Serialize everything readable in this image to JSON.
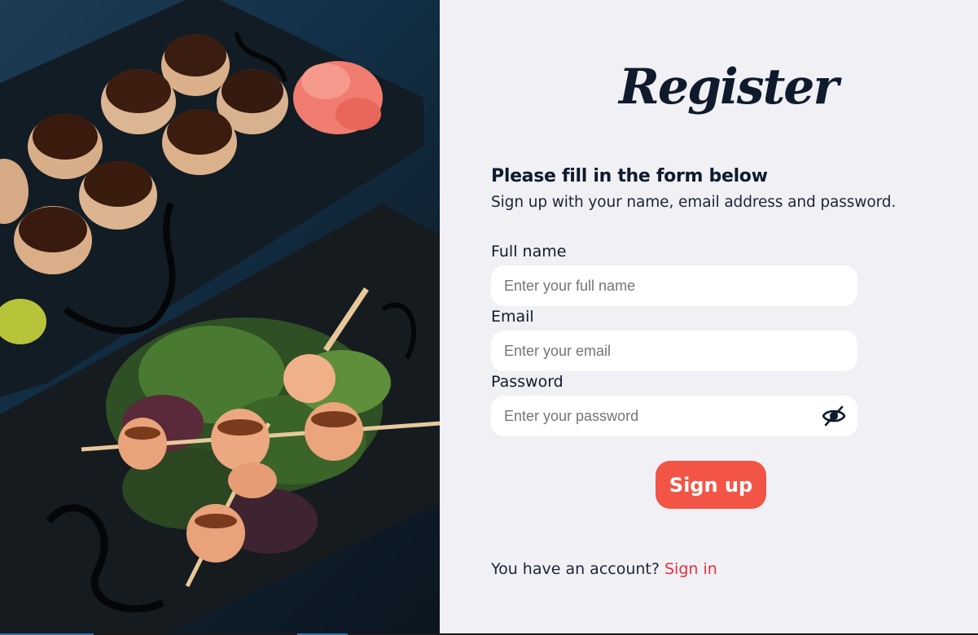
{
  "brand": {
    "title": "Register"
  },
  "form": {
    "heading": "Please fill in the form below",
    "subheading": "Sign up with your name, email address and password.",
    "fields": [
      {
        "label": "Full name",
        "placeholder": "Enter your full name",
        "value": ""
      },
      {
        "label": "Email",
        "placeholder": "Enter your email",
        "value": ""
      },
      {
        "label": "Password",
        "placeholder": "Enter your password",
        "value": "",
        "toggle_icon": "eye-slash-icon"
      }
    ],
    "submit_label": "Sign up"
  },
  "footer": {
    "prompt": "You have an account?",
    "link_label": "Sign in"
  },
  "colors": {
    "accent": "#f25546",
    "link": "#e2333d",
    "text": "#0f1b2d",
    "background": "#f0f0f5",
    "field_bg": "#ffffff"
  }
}
